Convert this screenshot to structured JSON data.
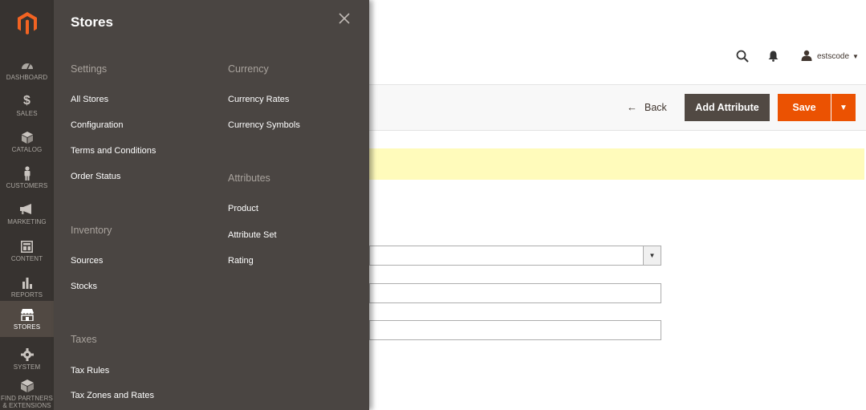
{
  "nav": {
    "logo_icon": "magento-logo-icon",
    "items": [
      {
        "label": "DASHBOARD",
        "icon": "dashboard-icon"
      },
      {
        "label": "SALES",
        "icon": "dollar-icon"
      },
      {
        "label": "CATALOG",
        "icon": "cube-icon"
      },
      {
        "label": "CUSTOMERS",
        "icon": "person-icon"
      },
      {
        "label": "MARKETING",
        "icon": "megaphone-icon"
      },
      {
        "label": "CONTENT",
        "icon": "content-icon"
      },
      {
        "label": "REPORTS",
        "icon": "bar-chart-icon"
      },
      {
        "label": "STORES",
        "icon": "storefront-icon",
        "active": true
      },
      {
        "label": "SYSTEM",
        "icon": "gear-icon"
      },
      {
        "label_line1": "FIND PARTNERS",
        "label_line2": "& EXTENSIONS",
        "icon": "puzzle-cube-icon"
      }
    ],
    "colors": {
      "background": "#373330",
      "active": "#514943"
    }
  },
  "flyout": {
    "title": "Stores",
    "sections": {
      "settings": {
        "title": "Settings",
        "links": [
          "All Stores",
          "Configuration",
          "Terms and Conditions",
          "Order Status"
        ]
      },
      "inventory": {
        "title": "Inventory",
        "links": [
          "Sources",
          "Stocks"
        ]
      },
      "taxes": {
        "title": "Taxes",
        "links": [
          "Tax Rules",
          "Tax Zones and Rates"
        ]
      },
      "currency": {
        "title": "Currency",
        "links": [
          "Currency Rates",
          "Currency Symbols"
        ]
      },
      "attributes": {
        "title": "Attributes",
        "links": [
          "Product",
          "Attribute Set",
          "Rating"
        ]
      }
    }
  },
  "header": {
    "search_icon": "search-icon",
    "notifications_icon": "bell-icon",
    "user": {
      "name": "estscode",
      "icon": "user-icon"
    }
  },
  "actions": {
    "back_label": "Back",
    "add_attribute_label": "Add Attribute",
    "save_label": "Save"
  },
  "colors": {
    "accent": "#eb5202",
    "secondary_button": "#514943",
    "notice": "#fffbbb",
    "flyout": "#4a4542"
  }
}
